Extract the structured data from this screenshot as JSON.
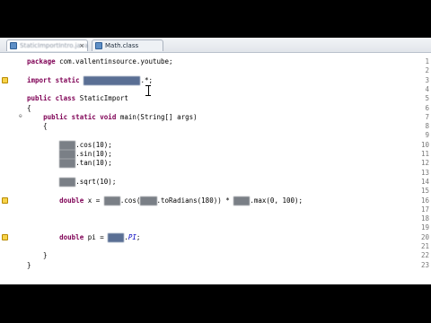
{
  "tabs": [
    {
      "label": "StaticImportIntro.java",
      "active": true
    },
    {
      "label": "Math.class",
      "active": false
    }
  ],
  "lines": [
    {
      "num": "1",
      "text": "package com.vallentinsource.youtube;"
    },
    {
      "num": "2",
      "text": ""
    },
    {
      "num": "3",
      "text": "import static ",
      "blur": "java.lang.Math",
      "after": ".*;"
    },
    {
      "num": "4",
      "text": ""
    },
    {
      "num": "5",
      "text": "public class StaticImport"
    },
    {
      "num": "6",
      "text": "{"
    },
    {
      "num": "7",
      "text": "    public static void main(String[] args)"
    },
    {
      "num": "8",
      "text": "    {"
    },
    {
      "num": "9",
      "text": ""
    },
    {
      "num": "10",
      "text": "        ",
      "blur": "Math",
      "after": ".cos(10);"
    },
    {
      "num": "11",
      "text": "        ",
      "blur": "Math",
      "after": ".sin(10);"
    },
    {
      "num": "12",
      "text": "        ",
      "blur": "Math",
      "after": ".tan(10);"
    },
    {
      "num": "13",
      "text": ""
    },
    {
      "num": "14",
      "text": "        ",
      "blur": "Math",
      "after": ".sqrt(10);"
    },
    {
      "num": "15",
      "text": ""
    },
    {
      "num": "16",
      "text": "        double x = ",
      "blur": "Math",
      "after": ".cos(",
      "blur2": "Math",
      "after2": ".toRadians(180)) * ",
      "blur3": "Math",
      "after3": ".max(0, 100);"
    },
    {
      "num": "17",
      "text": ""
    },
    {
      "num": "18",
      "text": ""
    },
    {
      "num": "19",
      "text": ""
    },
    {
      "num": "20",
      "text": "        double pi = ",
      "blur": "Math",
      "after": ".",
      "italic": "PI",
      "after2": ";"
    },
    {
      "num": "21",
      "text": ""
    },
    {
      "num": "22",
      "text": "    }"
    },
    {
      "num": "23",
      "text": "}"
    }
  ]
}
